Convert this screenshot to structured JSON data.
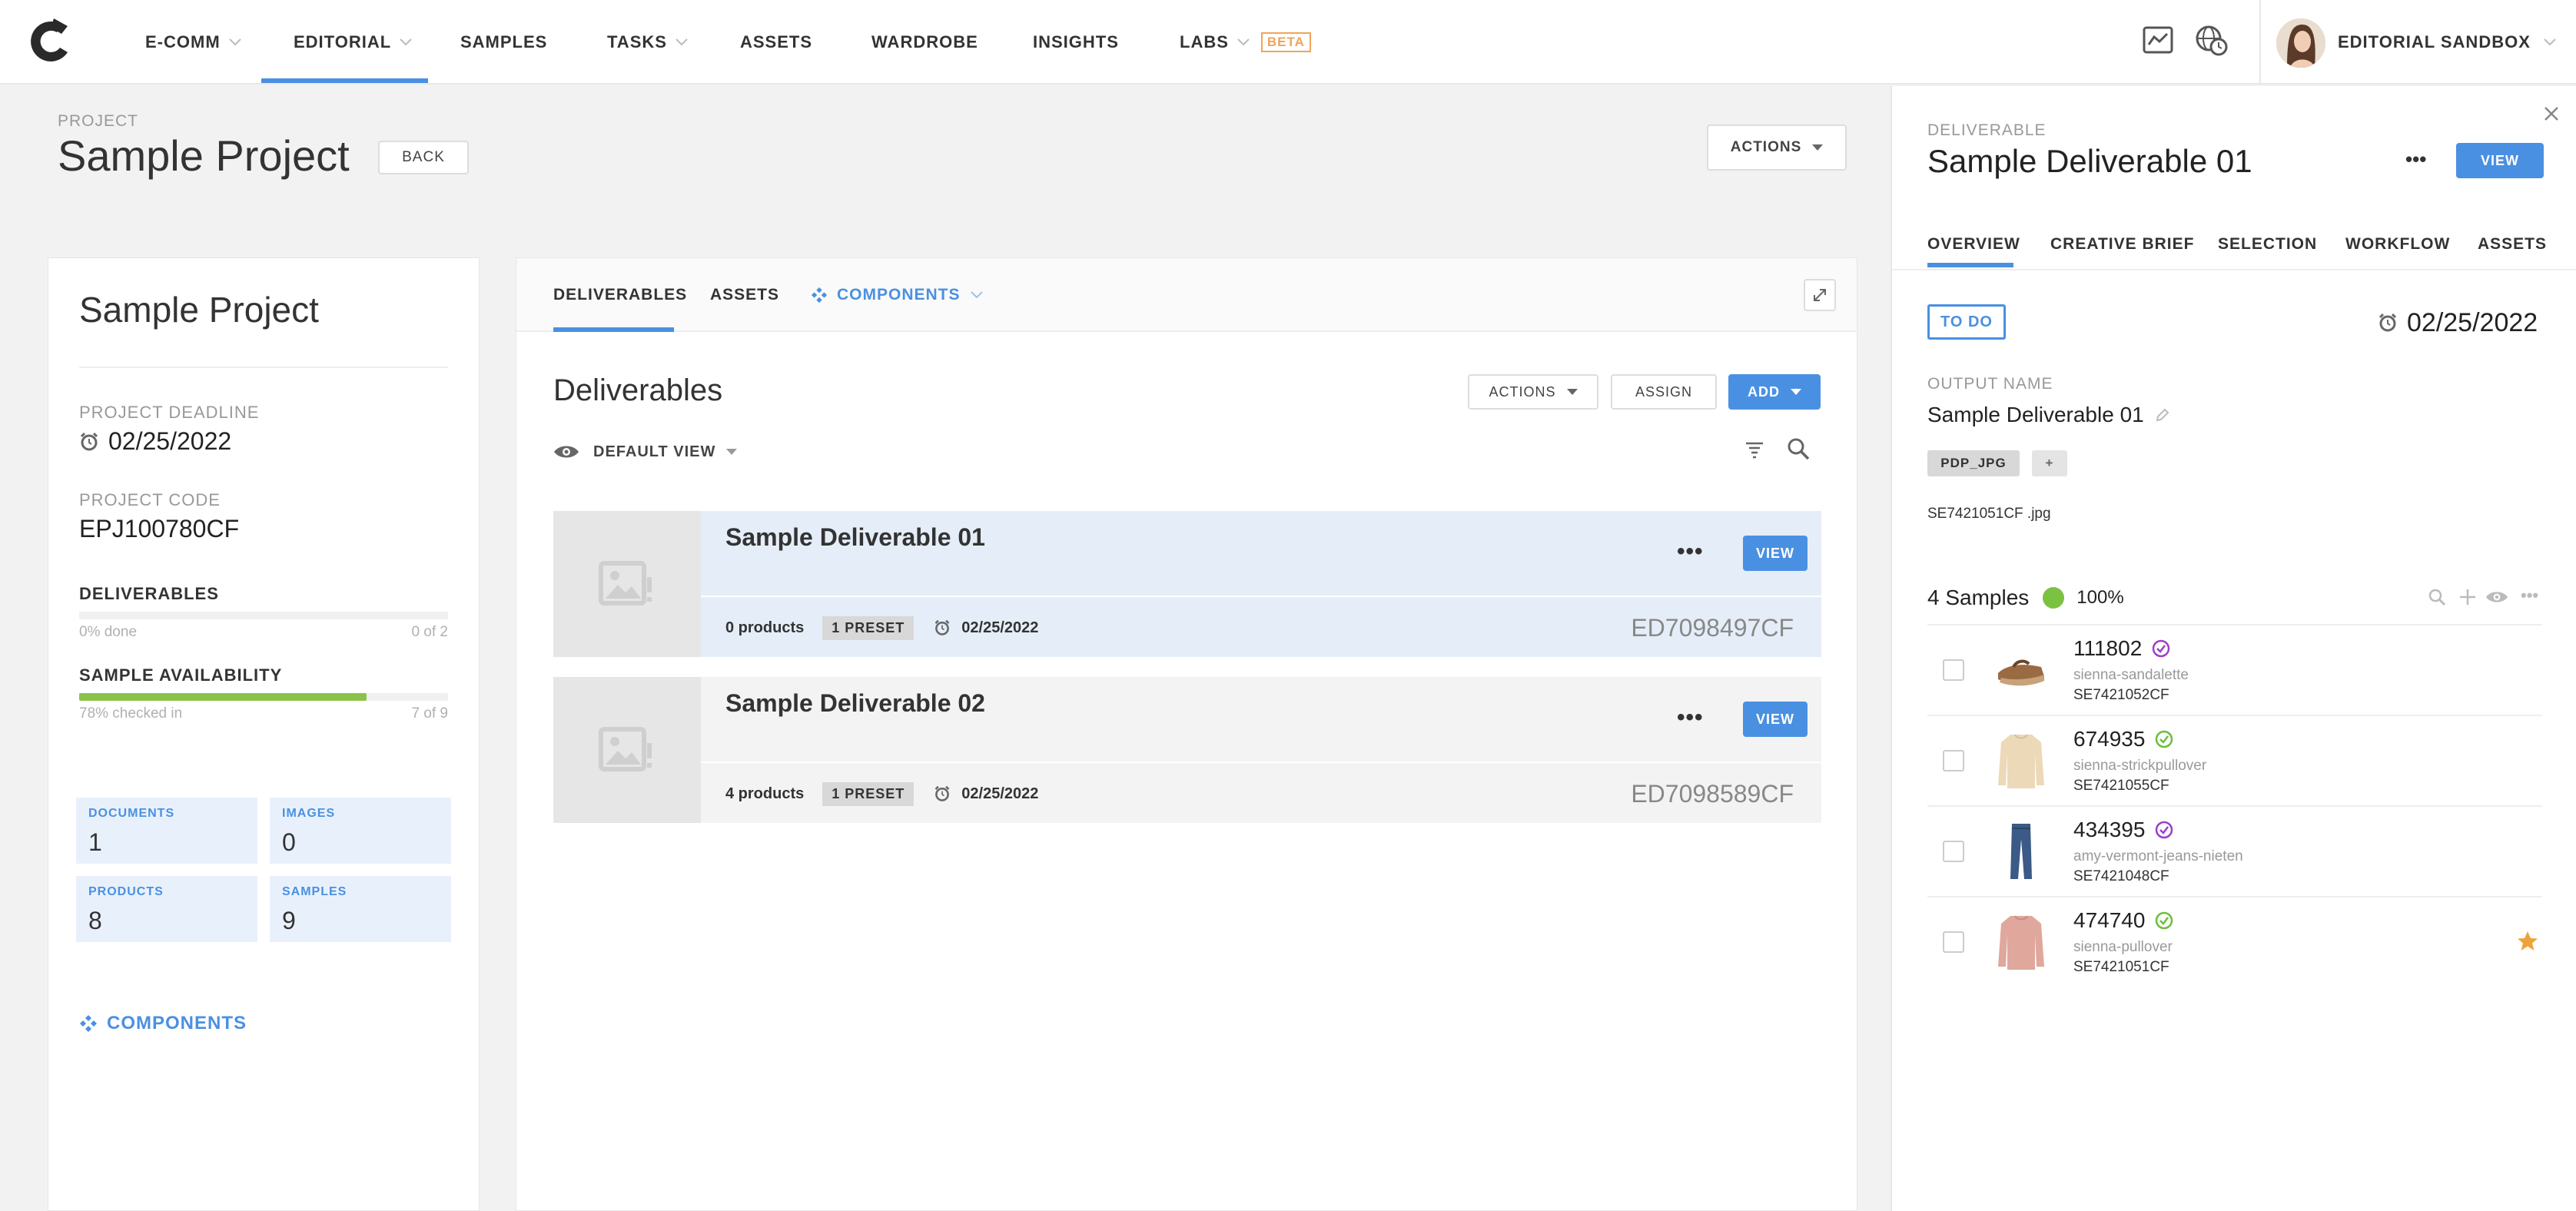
{
  "nav": {
    "items": [
      {
        "label": "E-COMM",
        "dropdown": true
      },
      {
        "label": "EDITORIAL",
        "dropdown": true
      },
      {
        "label": "SAMPLES",
        "dropdown": false
      },
      {
        "label": "TASKS",
        "dropdown": true
      },
      {
        "label": "ASSETS",
        "dropdown": false
      },
      {
        "label": "WARDROBE",
        "dropdown": false
      },
      {
        "label": "INSIGHTS",
        "dropdown": false
      },
      {
        "label": "LABS",
        "dropdown": true
      }
    ],
    "active": "EDITORIAL",
    "beta_label": "BETA",
    "user_name": "EDITORIAL SANDBOX",
    "accent": "#4a90e2"
  },
  "project": {
    "kicker": "PROJECT",
    "title": "Sample Project",
    "back_label": "BACK",
    "actions_label": "ACTIONS"
  },
  "left": {
    "title": "Sample Project",
    "deadline_label": "PROJECT DEADLINE",
    "deadline": "02/25/2022",
    "code_label": "PROJECT CODE",
    "code": "EPJ100780CF",
    "deliverables_label": "DELIVERABLES",
    "deliverables_done": "0% done",
    "deliverables_count": "0 of 2",
    "deliverables_progress": 0,
    "availability_label": "SAMPLE AVAILABILITY",
    "availability_text": "78% checked in",
    "availability_count": "7 of 9",
    "availability_progress": 0.78,
    "components_label": "COMPONENTS",
    "tiles": [
      {
        "label": "DOCUMENTS",
        "value": "1"
      },
      {
        "label": "IMAGES",
        "value": "0"
      },
      {
        "label": "PRODUCTS",
        "value": "8"
      },
      {
        "label": "SAMPLES",
        "value": "9"
      }
    ]
  },
  "middle": {
    "tabs": [
      "DELIVERABLES",
      "ASSETS",
      "COMPONENTS"
    ],
    "heading": "Deliverables",
    "actions_label": "ACTIONS",
    "assign_label": "ASSIGN",
    "add_label": "ADD",
    "view_label": "DEFAULT VIEW",
    "rows": [
      {
        "name": "Sample Deliverable 01",
        "products": "0 products",
        "preset": "1 PRESET",
        "date": "02/25/2022",
        "code": "ED7098497CF",
        "view": "VIEW",
        "selected": true
      },
      {
        "name": "Sample Deliverable 02",
        "products": "4 products",
        "preset": "1 PRESET",
        "date": "02/25/2022",
        "code": "ED7098589CF",
        "view": "VIEW",
        "selected": false
      }
    ]
  },
  "panel": {
    "kicker": "DELIVERABLE",
    "title": "Sample Deliverable 01",
    "view_label": "VIEW",
    "tabs": [
      "OVERVIEW",
      "CREATIVE BRIEF",
      "SELECTION",
      "WORKFLOW",
      "ASSETS"
    ],
    "status": "TO DO",
    "date": "02/25/2022",
    "output_label": "OUTPUT NAME",
    "output_name": "Sample Deliverable 01",
    "chip": "PDP_JPG",
    "chip_add": "+",
    "filename": "SE7421051CF .jpg",
    "samples_label": "4 Samples",
    "samples_pct": "100%",
    "samples": [
      {
        "number": "111802",
        "slug": "sienna-sandalette",
        "sku": "SE7421052CF",
        "status": "purple",
        "starred": false,
        "kind": "sandal"
      },
      {
        "number": "674935",
        "slug": "sienna-strickpullover",
        "sku": "SE7421055CF",
        "status": "green",
        "starred": false,
        "kind": "sweater-cream"
      },
      {
        "number": "434395",
        "slug": "amy-vermont-jeans-nieten",
        "sku": "SE7421048CF",
        "status": "purple",
        "starred": false,
        "kind": "jeans"
      },
      {
        "number": "474740",
        "slug": "sienna-pullover",
        "sku": "SE7421051CF",
        "status": "green",
        "starred": true,
        "kind": "sweater-pink"
      }
    ]
  }
}
